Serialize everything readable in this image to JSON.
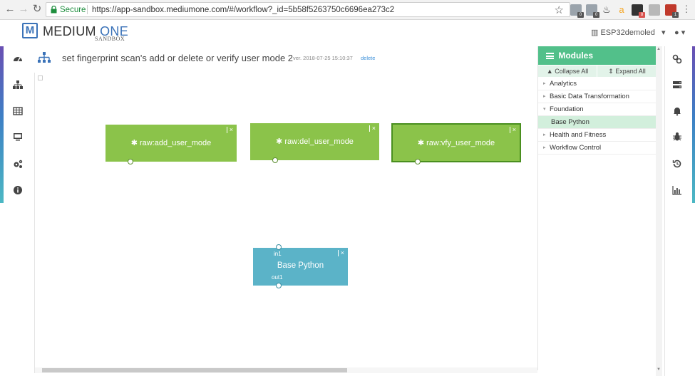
{
  "browser": {
    "secure_label": "Secure",
    "url": "https://app-sandbox.mediumone.com/#/workflow?_id=5b58f5263750c6696ea273c2",
    "extension_badges": [
      "0",
      "0",
      "8",
      "1"
    ]
  },
  "header": {
    "logo_icon": "M",
    "logo_medium": "MEDIUM",
    "logo_one": "ONE",
    "logo_sub": "SANDBOX",
    "account": "ESP32demoled",
    "account_caret": "▾",
    "user_caret": "▾"
  },
  "workflow": {
    "title": "set fingerprint scan's add or delete or verify user mode 2",
    "version": "ver. 2018-07-25 15:10:37",
    "delete_label": "delete"
  },
  "nodes": {
    "add": {
      "label": "✱ raw:add_user_mode",
      "close": "×"
    },
    "del": {
      "label": "✱ raw:del_user_mode",
      "close": "×"
    },
    "vfy": {
      "label": "✱ raw:vfy_user_mode",
      "close": "×"
    },
    "python": {
      "label": "Base Python",
      "in_label": "in1",
      "out_label": "out1",
      "close": "×"
    }
  },
  "modules": {
    "header": "Modules",
    "collapse_all": "▲ Collapse All",
    "expand_all": "⇕ Expand All",
    "items": [
      {
        "label": "Analytics",
        "caret": "▸"
      },
      {
        "label": "Basic Data Transformation",
        "caret": "▸"
      },
      {
        "label": "Foundation",
        "caret": "▾"
      },
      {
        "label": "Base Python",
        "caret": ""
      },
      {
        "label": "Health and Fitness",
        "caret": "▸"
      },
      {
        "label": "Workflow Control",
        "caret": "▸"
      }
    ]
  },
  "colors": {
    "module_header": "#52c08a",
    "node_green": "#8bc34a",
    "node_blue": "#5bb3c8",
    "accent_blue": "#3a72b8"
  }
}
